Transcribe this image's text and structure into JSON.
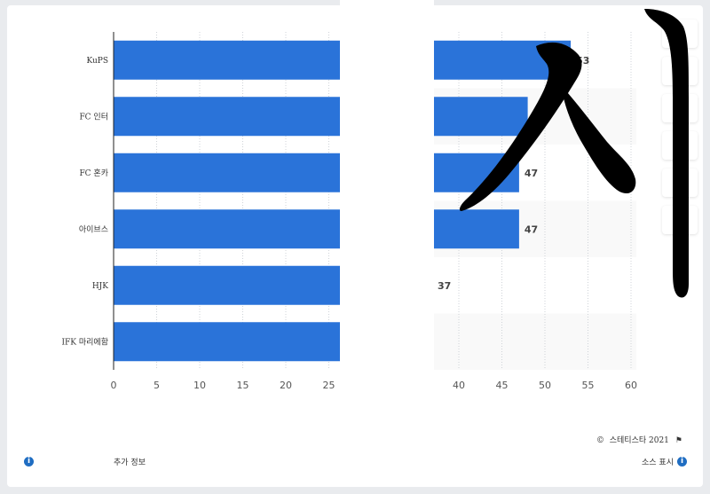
{
  "chart_data": {
    "type": "bar",
    "orientation": "horizontal",
    "categories": [
      "KuPS",
      "FC 인터",
      "FC 혼카",
      "아이브스",
      "HJK",
      "IFK 마리에함"
    ],
    "values": [
      53,
      48,
      47,
      47,
      37,
      null
    ],
    "data_labels": [
      "53",
      "48",
      "47",
      "47",
      "37",
      ""
    ],
    "x_ticks_left": [
      "0",
      "5",
      "10",
      "15",
      "20",
      "25"
    ],
    "x_ticks_right": [
      "40",
      "45",
      "50",
      "55",
      "60"
    ],
    "grid": true,
    "bar_color": "#2a73d9"
  },
  "footer": {
    "copyright": "스테티스타 2021",
    "more_info": "추가 정보",
    "show_source": "소스 표시"
  },
  "colors": {
    "bar": "#2a73d9",
    "accent_icon": "#1f6dc2",
    "overlay": "#000000"
  }
}
